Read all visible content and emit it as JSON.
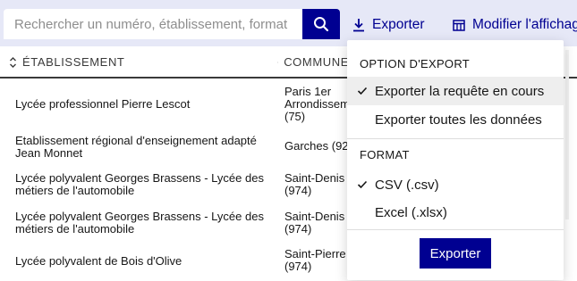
{
  "toolbar": {
    "search_placeholder": "Rechercher un numéro, établissement, format",
    "search_icon": "search-icon",
    "export_label": "Exporter",
    "export_icon": "download-icon",
    "display_label": "Modifier l'affichage",
    "display_icon": "table-icon"
  },
  "table": {
    "columns": [
      "ÉTABLISSEMENT",
      "COMMUNE"
    ],
    "rows": [
      {
        "name": "Lycée professionnel Pierre Lescot",
        "commune": [
          "Paris 1er",
          "Arrondissement",
          "(75)"
        ]
      },
      {
        "name": "Etablissement régional d'enseignement adapté Jean Monnet",
        "commune": [
          "Garches (92)"
        ]
      },
      {
        "name": "Lycée polyvalent Georges Brassens - Lycée des métiers de l'automobile",
        "commune": [
          "Saint-Denis",
          "(974)"
        ]
      },
      {
        "name": "Lycée polyvalent Georges Brassens - Lycée des métiers de l'automobile",
        "commune": [
          "Saint-Denis",
          "(974)"
        ]
      },
      {
        "name": "Lycée polyvalent de Bois d'Olive",
        "commune": [
          "Saint-Pierre",
          "(974)"
        ]
      }
    ]
  },
  "export_menu": {
    "option_title": "OPTION D'EXPORT",
    "options": [
      {
        "label": "Exporter la requête en cours",
        "checked": true
      },
      {
        "label": "Exporter toutes les données",
        "checked": false
      }
    ],
    "format_title": "FORMAT",
    "formats": [
      {
        "label": "CSV (.csv)",
        "checked": true
      },
      {
        "label": "Excel (.xlsx)",
        "checked": false
      }
    ],
    "submit_label": "Exporter"
  },
  "colors": {
    "primary": "#000091",
    "background": "#e6e8f7",
    "text": "#161616"
  }
}
